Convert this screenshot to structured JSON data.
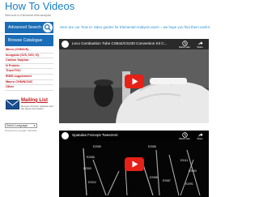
{
  "page": {
    "title": "How To Videos",
    "breadcrumb": "Welcome to Elemental Microanalysis"
  },
  "sidebar": {
    "search_label": "Advanced Search",
    "browse_label": "Browse Catalogue",
    "categories": [
      "Micro (CHNO/S)",
      "Inorganic (O/S, N/O, H)",
      "Carbon Sulphur",
      "N Protein",
      "Trace/TOC",
      "IRMS supplement",
      "Macro CHN/NCN/C",
      "Other"
    ],
    "mailing": {
      "title": "Mailing List",
      "text": "Receive Product Updates and the latest information"
    },
    "language": {
      "selected": "Select Language",
      "powered": "Powered by Google Translate"
    }
  },
  "main": {
    "intro": "Here are our 'how to' video guides for Elemental Analysis users – we hope you find them useful",
    "videos": [
      {
        "title": "Leco Combustion Tube CS844/CS230 Conversion Kit C...",
        "watch_later": "Watch later",
        "share": "Share"
      },
      {
        "title": "Spatulas Forceps Tweezers",
        "watch_later": "Watch later",
        "share": "Share",
        "numbers": [
          "E2089",
          "E2085",
          "E2088",
          "E3111",
          "E2300",
          "E2312",
          "E2086",
          "E2087",
          "E2090",
          "E2091"
        ]
      }
    ]
  },
  "colors": {
    "brand_blue": "#1a6db6",
    "link_red": "#c0171e",
    "title_blue": "#1a7fc4",
    "play_red": "#e62117"
  },
  "icons": {
    "search": "search-icon",
    "mail": "mail-icon",
    "channel": "channel-logo-icon",
    "watch_later": "clock-icon",
    "share": "share-icon",
    "play": "play-icon"
  }
}
